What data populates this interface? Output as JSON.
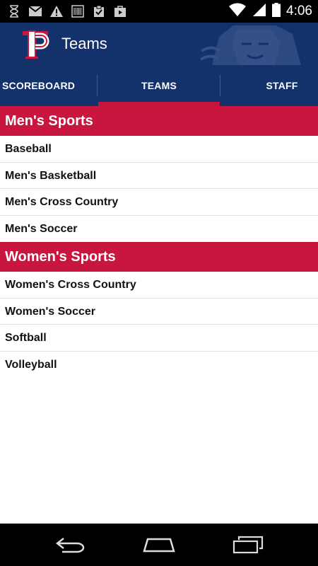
{
  "status_bar": {
    "time": "4:06",
    "left_icons": [
      "hourglass-icon",
      "gmail-icon",
      "warning-icon",
      "barcode-icon",
      "clipboard-check-icon",
      "play-store-icon"
    ],
    "right_icons": [
      "wifi-icon",
      "signal-icon",
      "battery-icon"
    ]
  },
  "app_bar": {
    "title": "Teams",
    "logo_letter": "P"
  },
  "tabs": [
    {
      "label": "SCOREBOARD",
      "selected": false
    },
    {
      "label": "TEAMS",
      "selected": true
    },
    {
      "label": "STAFF",
      "selected": false
    }
  ],
  "sections": [
    {
      "header": "Men's Sports",
      "items": [
        "Baseball",
        "Men's Basketball",
        "Men's Cross Country",
        "Men's Soccer"
      ]
    },
    {
      "header": "Women's Sports",
      "items": [
        "Women's Cross Country",
        "Women's Soccer",
        "Softball",
        "Volleyball"
      ]
    }
  ],
  "colors": {
    "brand_navy": "#13316b",
    "brand_red": "#c8163f",
    "tab_indicator": "#c8133b"
  },
  "nav_bar": [
    "back-icon",
    "home-icon",
    "recent-apps-icon"
  ]
}
